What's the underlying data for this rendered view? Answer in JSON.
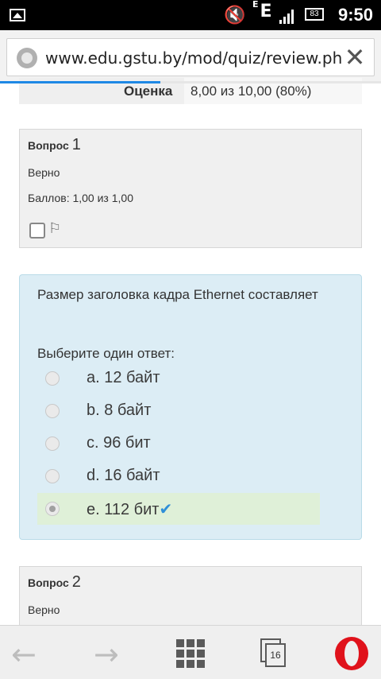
{
  "status_bar": {
    "network": "E",
    "network_superscript": "E",
    "battery": "83",
    "time": "9:50"
  },
  "browser": {
    "url": "www.edu.gstu.by/mod/quiz/review.php?attempt",
    "page_load_progress": 0.42,
    "tab_count": "16"
  },
  "summary": {
    "grade_label": "Оценка",
    "grade_value": "8,00 из 10,00 (80%)"
  },
  "question1": {
    "title_prefix": "Вопрос",
    "number": "1",
    "state": "Верно",
    "grade": "Баллов: 1,00 из 1,00"
  },
  "formulation": {
    "text": "Размер заголовка кадра Ethernet составляет",
    "prompt": "Выберите один ответ:",
    "answers": [
      {
        "label": "a. 12 байт",
        "selected": false,
        "correct": false
      },
      {
        "label": "b. 8 байт",
        "selected": false,
        "correct": false
      },
      {
        "label": "c. 96 бит",
        "selected": false,
        "correct": false
      },
      {
        "label": "d. 16 байт",
        "selected": false,
        "correct": false
      },
      {
        "label": "e. 112 бит",
        "selected": true,
        "correct": true
      }
    ],
    "check_mark": "✔"
  },
  "question2": {
    "title_prefix": "Вопрос",
    "number": "2",
    "state": "Верно"
  },
  "colors": {
    "accent": "#1e88e5",
    "correct_bg": "#dff0d8",
    "formulation_bg": "#dcedf5",
    "opera_red": "#e0121b"
  }
}
